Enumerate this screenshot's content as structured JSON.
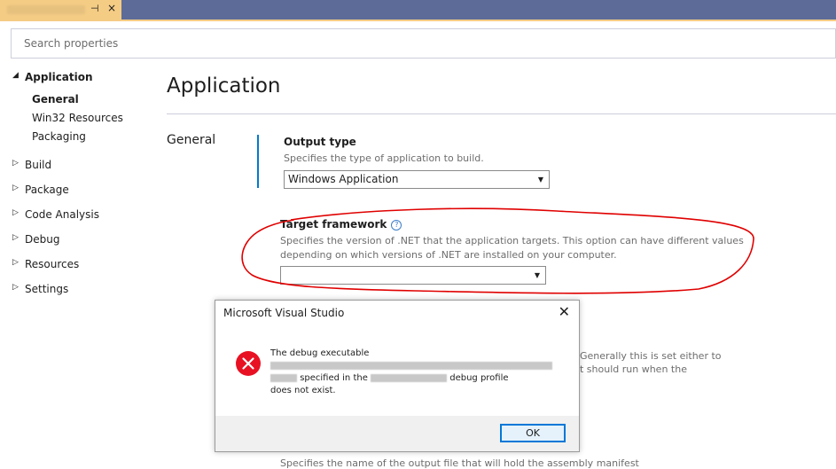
{
  "tab": {
    "pin_glyph": "⊣",
    "close_glyph": "×"
  },
  "search": {
    "placeholder": "Search properties"
  },
  "nav": {
    "application": "Application",
    "general": "General",
    "win32": "Win32 Resources",
    "packaging": "Packaging",
    "build": "Build",
    "package": "Package",
    "code_analysis": "Code Analysis",
    "debug": "Debug",
    "resources": "Resources",
    "settings": "Settings"
  },
  "main": {
    "title": "Application",
    "section": "General",
    "output_type": {
      "title": "Output type",
      "desc": "Specifies the type of application to build.",
      "value": "Windows Application"
    },
    "target_framework": {
      "title": "Target framework",
      "desc1": "Specifies the version of .NET that the application targets. This option can have different values",
      "desc2": "depending on which versions of .NET are installed on your computer.",
      "value": ""
    },
    "behind_text1": "Generally this is set either to",
    "behind_text2": "t should run when the",
    "behind_text3": "Specifies the name of the output file that will hold the assembly manifest"
  },
  "dialog": {
    "title": "Microsoft Visual Studio",
    "close_glyph": "✕",
    "line1": "The debug executable",
    "specified_in": "specified in the",
    "debug_profile": "debug profile",
    "not_exist": "does not exist.",
    "ok": "OK"
  },
  "colors": {
    "accent": "#007acc",
    "tab": "#f5cc84",
    "topbar": "#5d6b99",
    "error": "#e81123",
    "annotation": "#e00000"
  }
}
